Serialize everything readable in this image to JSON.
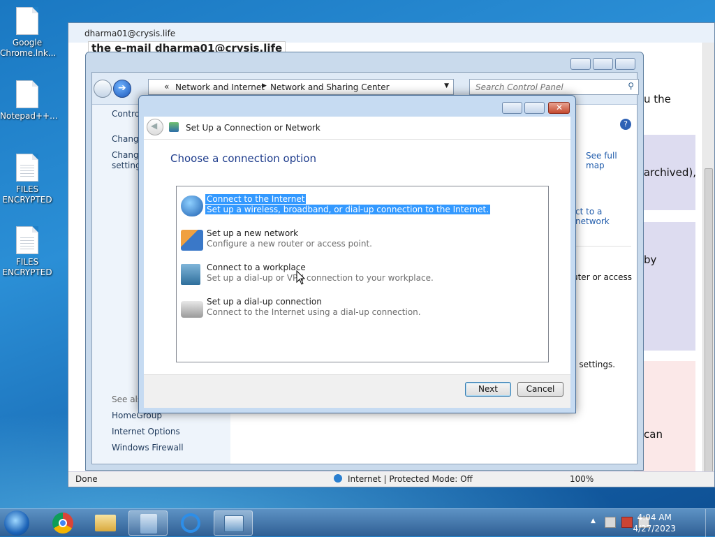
{
  "desktop": {
    "icons": [
      {
        "label": "Google Chrome.lnk..."
      },
      {
        "label": "Notepad++..."
      },
      {
        "label": "FILES ENCRYPTED"
      },
      {
        "label": "FILES ENCRYPTED"
      }
    ]
  },
  "browser": {
    "title": "dharma01@crysis.life",
    "banner_text": "the e-mail  dharma01@crysis.life",
    "status_left": "Done",
    "status_zone": "Internet | Protected Mode: Off",
    "zoom": "100%",
    "side_texts": [
      "u the",
      "(archived),",
      "by",
      "can"
    ]
  },
  "control_panel": {
    "breadcrumb": [
      "Network and Internet",
      "Network and Sharing Center"
    ],
    "search_placeholder": "Search Control Panel",
    "left_items": [
      "Control",
      "Change",
      "Change",
      "settings"
    ],
    "see_also_label": "See also",
    "see_also": [
      "HomeGroup",
      "Internet Options",
      "Windows Firewall"
    ],
    "right_links": [
      "See full map",
      "ct to a network",
      "uter or access",
      "g settings."
    ]
  },
  "dialog": {
    "title": "Set Up a Connection or Network",
    "heading": "Choose a connection option",
    "options": [
      {
        "title": "Connect to the Internet",
        "desc": "Set up a wireless, broadband, or dial-up connection to the Internet.",
        "selected": true,
        "icon": "globe-icon"
      },
      {
        "title": "Set up a new network",
        "desc": "Configure a new router or access point.",
        "selected": false,
        "icon": "network-icon"
      },
      {
        "title": "Connect to a workplace",
        "desc": "Set up a dial-up or VPN connection to your workplace.",
        "selected": false,
        "icon": "workplace-icon"
      },
      {
        "title": "Set up a dial-up connection",
        "desc": "Connect to the Internet using a dial-up connection.",
        "selected": false,
        "icon": "phone-icon"
      }
    ],
    "next_label": "Next",
    "cancel_label": "Cancel"
  },
  "taskbar": {
    "time": "4:04 AM",
    "date": "4/27/2023"
  }
}
